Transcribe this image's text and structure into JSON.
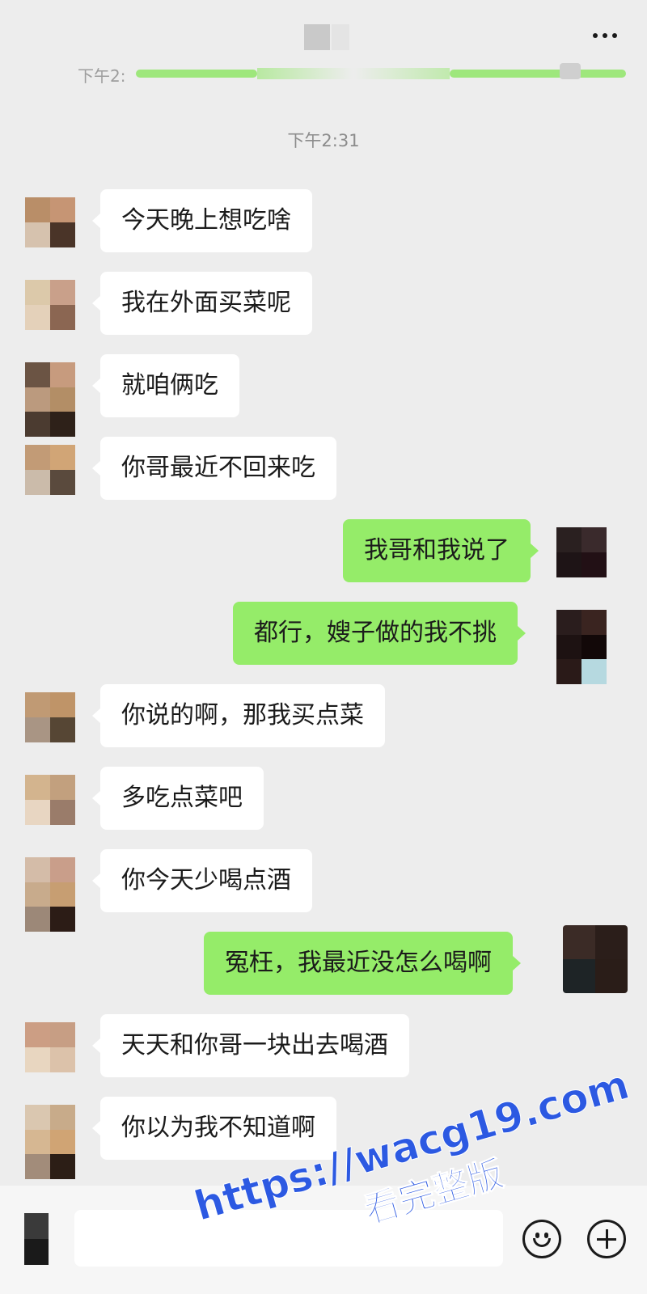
{
  "header": {
    "title_redacted": true,
    "more_icon": "more-horizontal-icon"
  },
  "pinned": {
    "time": "下午2:"
  },
  "timestamp": "下午2:31",
  "messages": [
    {
      "side": "left",
      "text": "今天晚上想吃啥"
    },
    {
      "side": "left",
      "text": "我在外面买菜呢"
    },
    {
      "side": "left",
      "text": "就咱俩吃"
    },
    {
      "side": "left",
      "text": "你哥最近不回来吃"
    },
    {
      "side": "right",
      "text": "我哥和我说了"
    },
    {
      "side": "right",
      "text": "都行，嫂子做的我不挑"
    },
    {
      "side": "left",
      "text": "你说的啊，那我买点菜"
    },
    {
      "side": "left",
      "text": "多吃点菜吧"
    },
    {
      "side": "left",
      "text": "你今天少喝点酒"
    },
    {
      "side": "right",
      "text": "冤枉，我最近没怎么喝啊"
    },
    {
      "side": "left",
      "text": "天天和你哥一块出去喝酒"
    },
    {
      "side": "left",
      "text": "你以为我不知道啊"
    }
  ],
  "input_bar": {
    "value": "",
    "voice_icon": "voice-icon",
    "emoji_icon": "emoji-icon",
    "plus_icon": "plus-icon"
  },
  "watermark": {
    "url": "https://wacg19.com",
    "subtitle": "看完整版"
  },
  "colors": {
    "background": "#ededed",
    "bubble_left": "#ffffff",
    "bubble_right": "#95ec69",
    "watermark": "#2c59e2"
  }
}
